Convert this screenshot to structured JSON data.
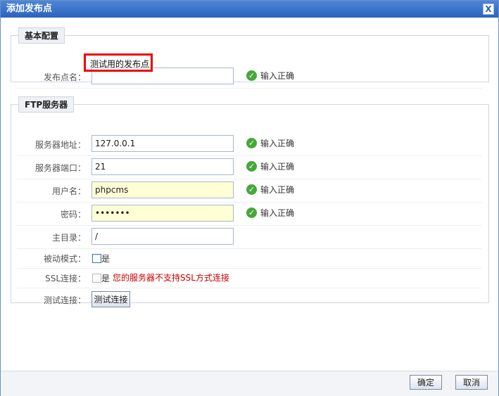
{
  "dialog": {
    "title": "添加发布点",
    "close_symbol": "X"
  },
  "basic": {
    "legend": "基本配置",
    "name_label": "发布点名：",
    "name_value": "测试用的发布点",
    "name_status": "输入正确"
  },
  "ftp": {
    "legend": "FTP服务器",
    "host_label": "服务器地址：",
    "host_value": "127.0.0.1",
    "host_status": "输入正确",
    "port_label": "服务器端口：",
    "port_value": "21",
    "port_status": "输入正确",
    "user_label": "用户名：",
    "user_value": "phpcms",
    "user_status": "输入正确",
    "pass_label": "密码：",
    "pass_value": "•••••••",
    "pass_status": "输入正确",
    "dir_label": "主目录：",
    "dir_value": "/",
    "pasv_label": "被动模式：",
    "pasv_option": "是",
    "ssl_label": "SSL连接：",
    "ssl_option": "是",
    "ssl_warning": "您的服务器不支持SSL方式连接",
    "test_label": "测试连接：",
    "test_button": "测试连接"
  },
  "footer": {
    "ok": "确定",
    "cancel": "取消"
  },
  "colors": {
    "title_bar": "#2a63bd",
    "success": "#46a839",
    "warning": "#cc0000",
    "highlight": "#ee0000"
  }
}
